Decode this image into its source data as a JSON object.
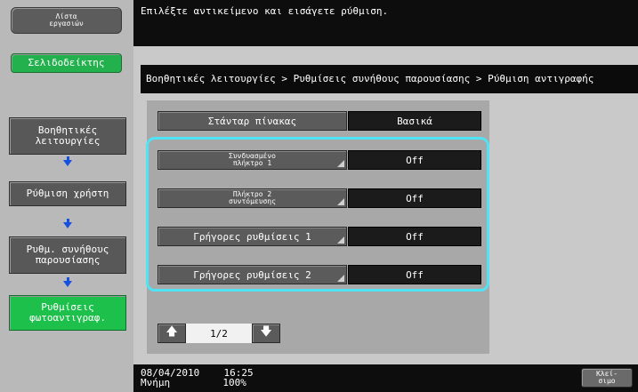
{
  "sidebar": {
    "job_list_label": "Λίστα\nεργασιών",
    "bookmark_label": "Σελιδοδείκτης",
    "steps": [
      {
        "label": "Βοηθητικές\nλειτουργίες"
      },
      {
        "label": "Ρύθμιση χρήστη"
      },
      {
        "label": "Ρυθμ. συνήθους\nπαρουσίασης"
      },
      {
        "label": "Ρυθμίσεις\nφωτοαντιγραφ."
      }
    ]
  },
  "header": {
    "message": "Επιλέξτε αντικείμενο και εισάγετε ρύθμιση."
  },
  "breadcrumb": {
    "text": "Βοηθητικές λειτουργίες > Ρυθμίσεις συνήθους παρουσίασης > Ρύθμιση αντιγραφής"
  },
  "settings": [
    {
      "label": "Στάνταρ πίνακας",
      "value": "Βασικά"
    },
    {
      "label_line1": "Συνδυασμένο",
      "label_line2": "πλήκτρο 1",
      "value": "Off"
    },
    {
      "label_line1": "Πλήκτρο 2",
      "label_line2": "συντόμευσης",
      "value": "Off"
    },
    {
      "label": "Γρήγορες ρυθμίσεις 1",
      "value": "Off"
    },
    {
      "label": "Γρήγορες ρυθμίσεις 2",
      "value": "Off"
    }
  ],
  "pager": {
    "page_text": "1/2",
    "up_glyph": "🡅",
    "down_glyph": "🡇"
  },
  "status": {
    "date": "08/04/2010",
    "time": "16:25",
    "memory_label": "Μνήμη",
    "memory_value": "100%"
  },
  "close_button": {
    "line1": "Κλεί-",
    "line2": "σιμο"
  },
  "colors": {
    "highlight": "#4fe3f6",
    "active_green": "#1ec04c",
    "arrow_blue": "#1550e0"
  }
}
